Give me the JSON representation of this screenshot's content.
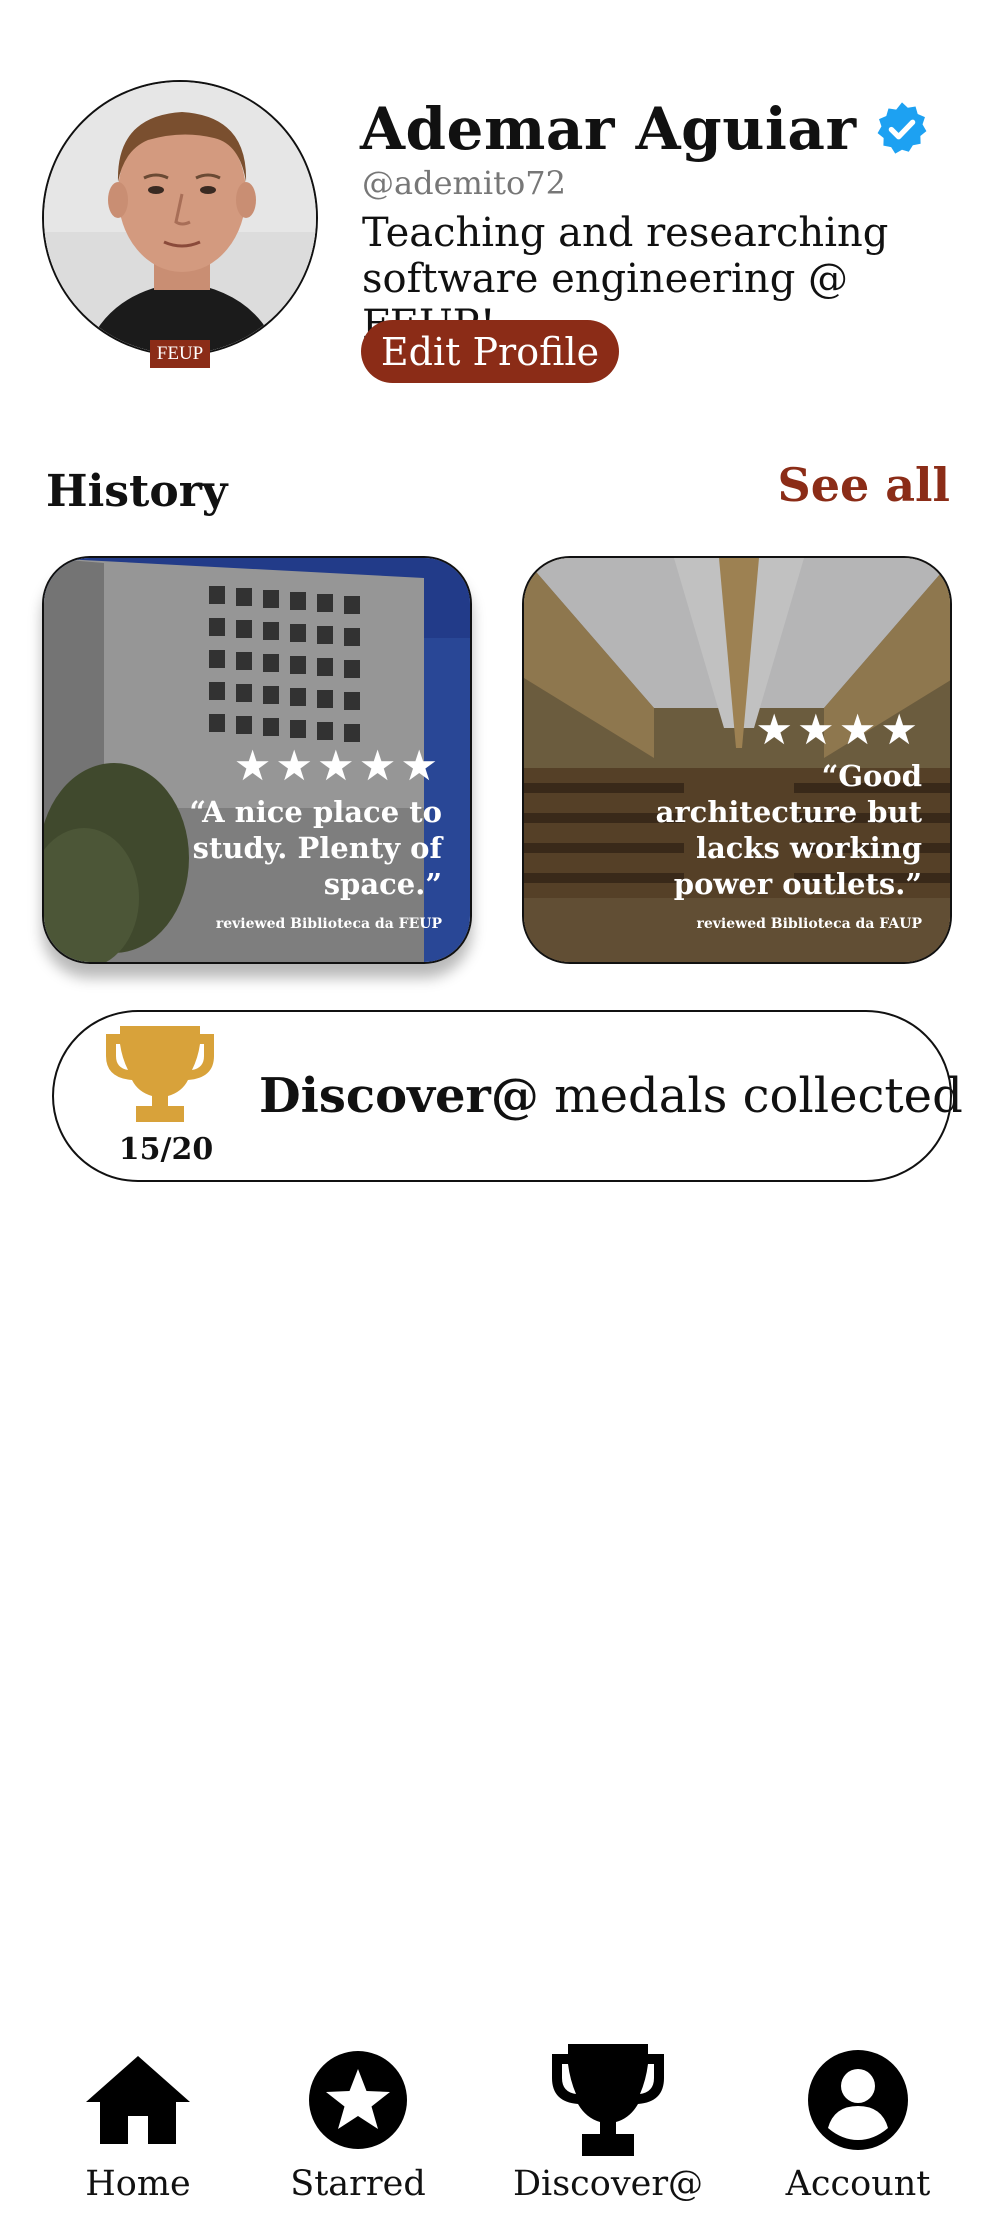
{
  "profile": {
    "name": "Ademar Aguiar",
    "handle": "@ademito72",
    "bio": "Teaching and researching software engineering @ FEUP!",
    "badge": "FEUP",
    "edit_label": "Edit Profile",
    "verified_icon": "verified-badge-icon"
  },
  "history": {
    "title": "History",
    "see_all": "See all",
    "cards": [
      {
        "rating": 5,
        "stars": "★★★★★",
        "quote": "“A nice place to study. Plenty of space.”",
        "reviewed": "reviewed Biblioteca da FEUP"
      },
      {
        "rating": 4,
        "stars": "★★★★",
        "quote": "“Good architecture but lacks working power outlets.”",
        "reviewed": "reviewed Biblioteca da FAUP"
      }
    ]
  },
  "medals": {
    "count": "15/20",
    "brand": "Discover@",
    "label": "medals collected",
    "icon": "trophy-icon"
  },
  "nav": {
    "items": [
      {
        "label": "Home",
        "icon": "home-icon"
      },
      {
        "label": "Starred",
        "icon": "star-icon"
      },
      {
        "label": "Discover@",
        "icon": "trophy-icon"
      },
      {
        "label": "Account",
        "icon": "account-icon"
      }
    ]
  },
  "colors": {
    "accent": "#8b2c17",
    "trophy": "#d8a23a",
    "verified": "#1da1f2"
  }
}
